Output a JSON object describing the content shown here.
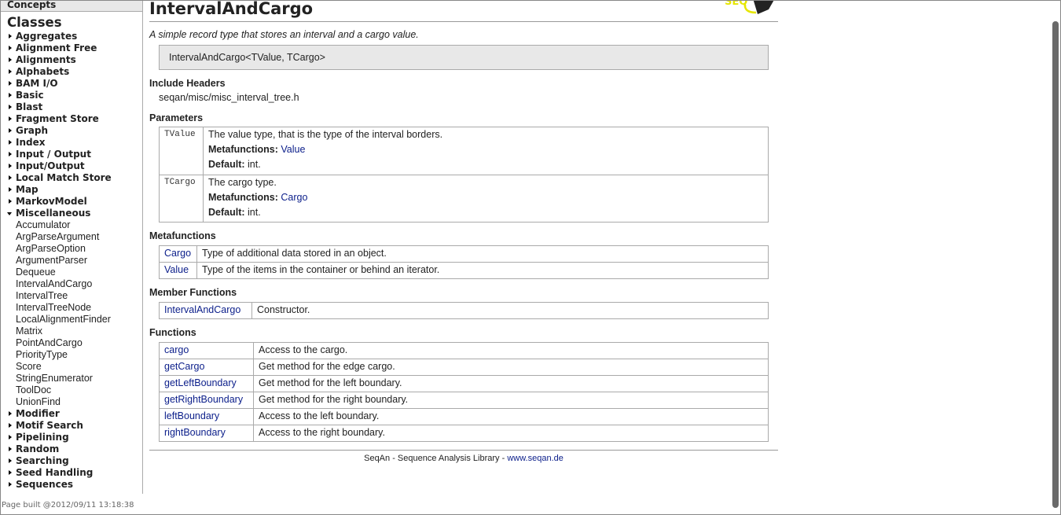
{
  "sidebar": {
    "concepts": "Concepts",
    "classes": "Classes",
    "items": [
      {
        "label": "Aggregates",
        "type": "cat"
      },
      {
        "label": "Alignment Free",
        "type": "cat"
      },
      {
        "label": "Alignments",
        "type": "cat"
      },
      {
        "label": "Alphabets",
        "type": "cat"
      },
      {
        "label": "BAM I/O",
        "type": "cat"
      },
      {
        "label": "Basic",
        "type": "cat"
      },
      {
        "label": "Blast",
        "type": "cat"
      },
      {
        "label": "Fragment Store",
        "type": "cat"
      },
      {
        "label": "Graph",
        "type": "cat"
      },
      {
        "label": "Index",
        "type": "cat"
      },
      {
        "label": "Input / Output",
        "type": "cat"
      },
      {
        "label": "Input/Output",
        "type": "cat"
      },
      {
        "label": "Local Match Store",
        "type": "cat"
      },
      {
        "label": "Map",
        "type": "cat"
      },
      {
        "label": "MarkovModel",
        "type": "cat"
      },
      {
        "label": "Miscellaneous",
        "type": "open"
      },
      {
        "label": "Accumulator",
        "type": "sub"
      },
      {
        "label": "ArgParseArgument",
        "type": "sub"
      },
      {
        "label": "ArgParseOption",
        "type": "sub"
      },
      {
        "label": "ArgumentParser",
        "type": "sub"
      },
      {
        "label": "Dequeue",
        "type": "sub"
      },
      {
        "label": "IntervalAndCargo",
        "type": "sub"
      },
      {
        "label": "IntervalTree",
        "type": "sub"
      },
      {
        "label": "IntervalTreeNode",
        "type": "sub"
      },
      {
        "label": "LocalAlignmentFinder",
        "type": "sub"
      },
      {
        "label": "Matrix",
        "type": "sub"
      },
      {
        "label": "PointAndCargo",
        "type": "sub"
      },
      {
        "label": "PriorityType",
        "type": "sub"
      },
      {
        "label": "Score",
        "type": "sub"
      },
      {
        "label": "StringEnumerator",
        "type": "sub"
      },
      {
        "label": "ToolDoc",
        "type": "sub"
      },
      {
        "label": "UnionFind",
        "type": "sub"
      },
      {
        "label": "Modifier",
        "type": "cat"
      },
      {
        "label": "Motif Search",
        "type": "cat"
      },
      {
        "label": "Pipelining",
        "type": "cat"
      },
      {
        "label": "Random",
        "type": "cat"
      },
      {
        "label": "Searching",
        "type": "cat"
      },
      {
        "label": "Seed Handling",
        "type": "cat"
      },
      {
        "label": "Sequences",
        "type": "cat"
      }
    ],
    "built": "Page built @2012/09/11 13:18:38"
  },
  "main": {
    "title": "IntervalAndCargo",
    "logo_text": "SEQAN",
    "description": "A simple record type that stores an interval and a cargo value.",
    "signature": "IntervalAndCargo<TValue, TCargo>",
    "include_heading": "Include Headers",
    "include": "seqan/misc/misc_interval_tree.h",
    "params_heading": "Parameters",
    "params": [
      {
        "name": "TValue",
        "desc": "The value type, that is the type of the interval borders.",
        "mf_label": "Metafunctions:",
        "mf": "Value",
        "def_label": "Default:",
        "def": "int."
      },
      {
        "name": "TCargo",
        "desc": "The cargo type.",
        "mf_label": "Metafunctions:",
        "mf": "Cargo",
        "def_label": "Default:",
        "def": "int."
      }
    ],
    "metafunctions_heading": "Metafunctions",
    "metafunctions": [
      {
        "name": "Cargo",
        "desc": "Type of additional data stored in an object."
      },
      {
        "name": "Value",
        "desc": "Type of the items in the container or behind an iterator."
      }
    ],
    "member_heading": "Member Functions",
    "members": [
      {
        "name": "IntervalAndCargo",
        "desc": "Constructor."
      }
    ],
    "functions_heading": "Functions",
    "functions": [
      {
        "name": "cargo",
        "desc": "Access to the cargo."
      },
      {
        "name": "getCargo",
        "desc": "Get method for the edge cargo."
      },
      {
        "name": "getLeftBoundary",
        "desc": "Get method for the left boundary."
      },
      {
        "name": "getRightBoundary",
        "desc": "Get method for the right boundary."
      },
      {
        "name": "leftBoundary",
        "desc": "Access to the left boundary."
      },
      {
        "name": "rightBoundary",
        "desc": "Access to the right boundary."
      }
    ],
    "footer_text": "SeqAn - Sequence Analysis Library - ",
    "footer_link": "www.seqan.de"
  }
}
